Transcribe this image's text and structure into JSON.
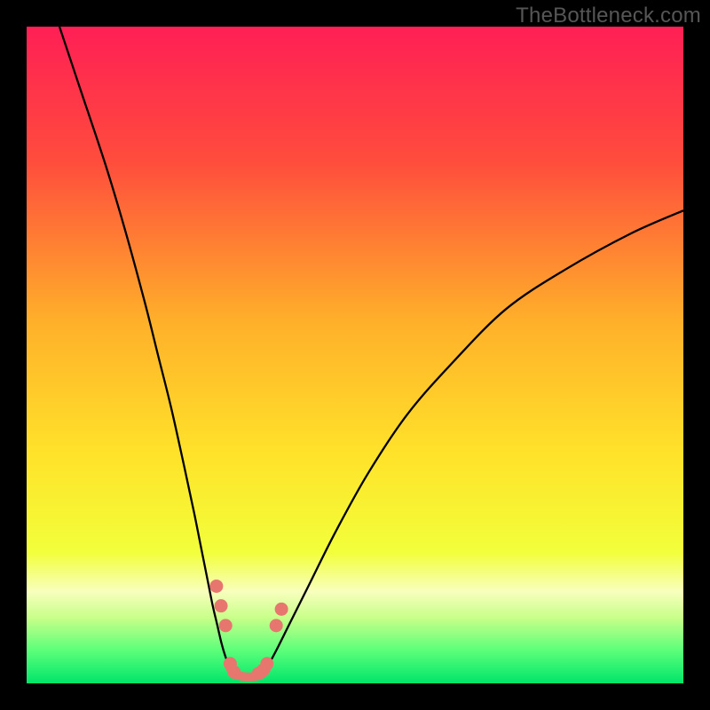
{
  "watermark": "TheBottleneck.com",
  "chart_data": {
    "type": "line",
    "title": "",
    "xlabel": "",
    "ylabel": "",
    "xlim": [
      0,
      100
    ],
    "ylim": [
      0,
      100
    ],
    "legend": false,
    "grid": false,
    "background_gradient_stops": [
      {
        "offset": 0,
        "color": "#ff1f55"
      },
      {
        "offset": 0.2,
        "color": "#ff4b3d"
      },
      {
        "offset": 0.45,
        "color": "#ffb02a"
      },
      {
        "offset": 0.65,
        "color": "#ffe22a"
      },
      {
        "offset": 0.8,
        "color": "#f2ff3a"
      },
      {
        "offset": 0.86,
        "color": "#f8ffbd"
      },
      {
        "offset": 0.9,
        "color": "#c8ff8a"
      },
      {
        "offset": 0.95,
        "color": "#5bff7a"
      },
      {
        "offset": 1.0,
        "color": "#00e56a"
      }
    ],
    "series": [
      {
        "name": "curve-left",
        "stroke": "#000000",
        "stroke_width": 2.3,
        "x": [
          5,
          8,
          12,
          15,
          18,
          20,
          22,
          24,
          25.5,
          26.5,
          27.5,
          28.3,
          29,
          29.7,
          30.3,
          31
        ],
        "y": [
          100,
          91,
          79,
          69,
          58,
          50,
          42,
          33,
          26,
          21,
          16,
          12,
          9,
          6,
          4,
          2.3
        ]
      },
      {
        "name": "curve-right",
        "stroke": "#000000",
        "stroke_width": 2.3,
        "x": [
          36.5,
          38,
          40,
          43,
          47,
          52,
          58,
          65,
          73,
          82,
          92,
          100
        ],
        "y": [
          2.2,
          5,
          9,
          15,
          23,
          32,
          41,
          49,
          57,
          63,
          68.5,
          72
        ]
      },
      {
        "name": "floor-overlay",
        "stroke": "#e7766f",
        "stroke_width": 10,
        "linecap": "round",
        "x": [
          31,
          31.5,
          32.3,
          33.3,
          34.3,
          35.3,
          36.2,
          36.5
        ],
        "y": [
          2.3,
          1.6,
          1.2,
          1.0,
          1.0,
          1.2,
          1.7,
          2.2
        ]
      }
    ],
    "markers": [
      {
        "series": "left",
        "x": 28.9,
        "y": 14.8,
        "r": 7.5,
        "fill": "#e7766f"
      },
      {
        "series": "left",
        "x": 29.6,
        "y": 11.8,
        "r": 7.5,
        "fill": "#e7766f"
      },
      {
        "series": "left",
        "x": 30.3,
        "y": 8.8,
        "r": 7.5,
        "fill": "#e7766f"
      },
      {
        "series": "left",
        "x": 31.0,
        "y": 3.0,
        "r": 7.5,
        "fill": "#e7766f"
      },
      {
        "series": "left",
        "x": 31.6,
        "y": 1.7,
        "r": 7.5,
        "fill": "#e7766f"
      },
      {
        "series": "right",
        "x": 35.3,
        "y": 1.5,
        "r": 7.5,
        "fill": "#e7766f"
      },
      {
        "series": "right",
        "x": 36.0,
        "y": 2.0,
        "r": 7.5,
        "fill": "#e7766f"
      },
      {
        "series": "right",
        "x": 36.6,
        "y": 3.0,
        "r": 7.5,
        "fill": "#e7766f"
      },
      {
        "series": "right",
        "x": 38.0,
        "y": 8.8,
        "r": 7.5,
        "fill": "#e7766f"
      },
      {
        "series": "right",
        "x": 38.8,
        "y": 11.3,
        "r": 7.5,
        "fill": "#e7766f"
      }
    ]
  }
}
